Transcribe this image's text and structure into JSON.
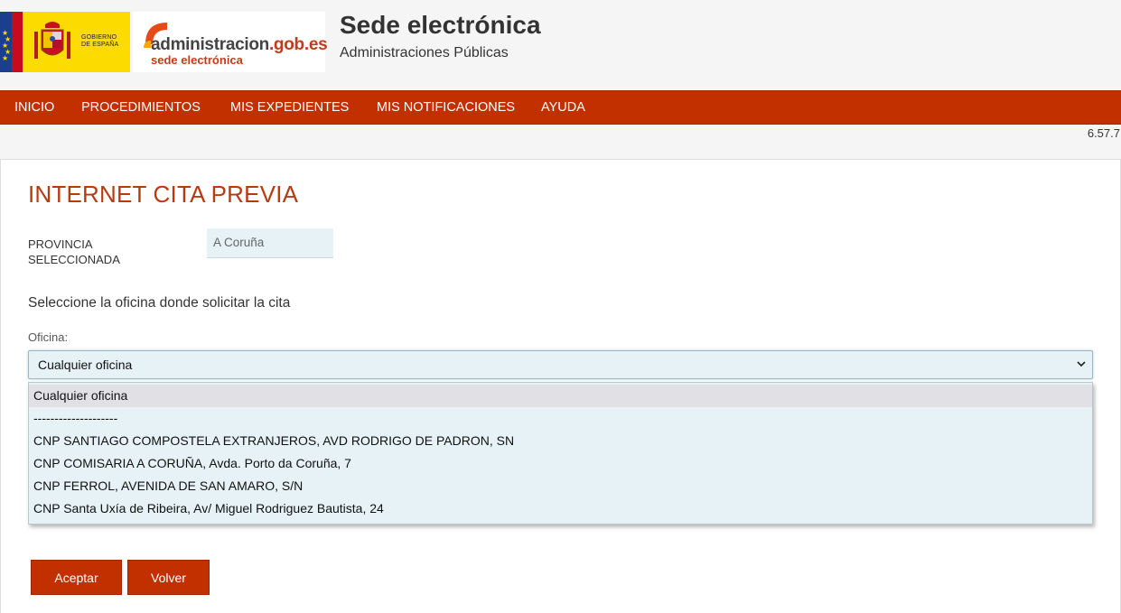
{
  "header": {
    "gob_logo_text": [
      "GOBIERNO",
      "DE ESPAÑA"
    ],
    "admin_logo": {
      "name_prefix": "administracion",
      "name_suffix": ".gob.es",
      "subtitle": "sede electrónica"
    },
    "title": "Sede electrónica",
    "subtitle": "Administraciones Públicas"
  },
  "nav": {
    "items": [
      {
        "label": "INICIO"
      },
      {
        "label": "PROCEDIMIENTOS"
      },
      {
        "label": "MIS EXPEDIENTES"
      },
      {
        "label": "MIS NOTIFICACIONES"
      },
      {
        "label": "AYUDA"
      }
    ]
  },
  "version": "6.57.7",
  "main": {
    "page_title": "INTERNET CITA PREVIA",
    "province": {
      "label": "PROVINCIA SELECCIONADA",
      "value": "A Coruña"
    },
    "instruction": "Seleccione la oficina donde solicitar la cita",
    "office": {
      "label": "Oficina:",
      "selected": "Cualquier oficina",
      "options": [
        "Cualquier oficina",
        "--------------------",
        "CNP SANTIAGO COMPOSTELA EXTRANJEROS, AVD RODRIGO DE PADRON, SN",
        "CNP COMISARIA A CORUÑA, Avda. Porto da Coruña, 7",
        "CNP FERROL, AVENIDA DE SAN AMARO, S/N",
        "CNP Santa Uxía de Ribeira, Av/ Miguel Rodriguez Bautista, 24"
      ]
    },
    "buttons": {
      "accept": "Aceptar",
      "back": "Volver"
    }
  },
  "colors": {
    "brand_red": "#c23000",
    "title_red": "#b83a10",
    "field_bg": "#e6f2f6"
  }
}
